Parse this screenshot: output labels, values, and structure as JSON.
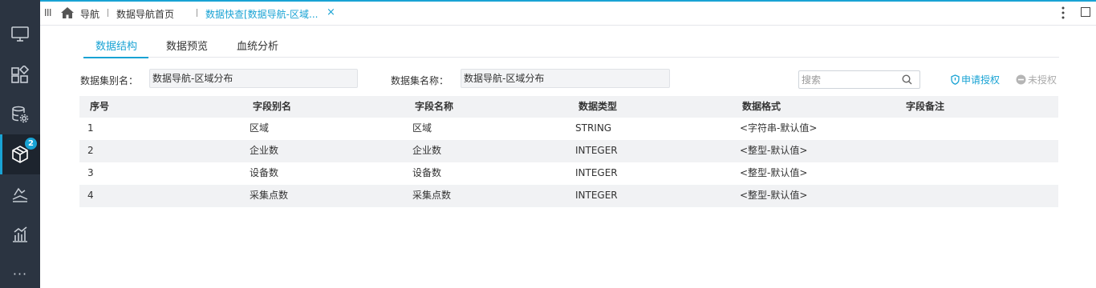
{
  "rail": {
    "badge_count": "2",
    "more_label": "···"
  },
  "tabbar": {
    "nav_label": "导航",
    "tabs": [
      "数据导航首页",
      "数据快查[数据导航-区域..."
    ],
    "close_label": "×"
  },
  "subtabs": [
    "数据结构",
    "数据预览",
    "血统分析"
  ],
  "form": {
    "alias_label": "数据集别名：",
    "alias_value": "数据导航-区域分布",
    "name_label": "数据集名称：",
    "name_value": "数据导航-区域分布"
  },
  "search": {
    "placeholder": "搜索"
  },
  "actions": {
    "apply_auth": "申请授权",
    "unauthorized": "未授权"
  },
  "table": {
    "headers": [
      "序号",
      "字段别名",
      "字段名称",
      "数据类型",
      "数据格式",
      "字段备注"
    ],
    "rows": [
      [
        "1",
        "区域",
        "区域",
        "STRING",
        "<字符串-默认值>",
        ""
      ],
      [
        "2",
        "企业数",
        "企业数",
        "INTEGER",
        "<整型-默认值>",
        ""
      ],
      [
        "3",
        "设备数",
        "设备数",
        "INTEGER",
        "<整型-默认值>",
        ""
      ],
      [
        "4",
        "采集点数",
        "采集点数",
        "INTEGER",
        "<整型-默认值>",
        ""
      ]
    ]
  },
  "colors": {
    "accent": "#19a3d4",
    "rail_bg": "#2b3441"
  }
}
